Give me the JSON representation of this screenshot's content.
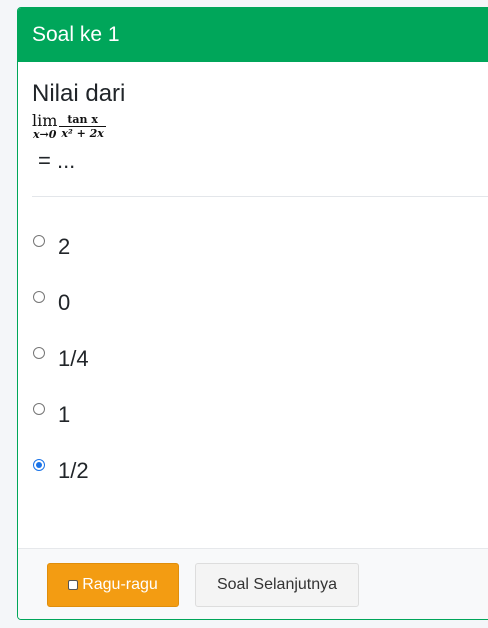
{
  "header": {
    "title": "Soal ke 1"
  },
  "question": {
    "text": "Nilai dari",
    "math": {
      "lim_word": "lim",
      "lim_sub": "x→0",
      "numerator": "tan x",
      "denominator": "x² + 2x"
    },
    "suffix": "= ..."
  },
  "options": [
    {
      "label": "2",
      "checked": false
    },
    {
      "label": "0",
      "checked": false
    },
    {
      "label": "1/4",
      "checked": false
    },
    {
      "label": "1",
      "checked": false
    },
    {
      "label": "1/2",
      "checked": true
    }
  ],
  "footer": {
    "ragu_label": "Ragu-ragu",
    "next_label": "Soal Selanjutnya"
  },
  "colors": {
    "header": "#00a65a",
    "ragu": "#f39c12",
    "radio_checked": "#1a73e8"
  }
}
